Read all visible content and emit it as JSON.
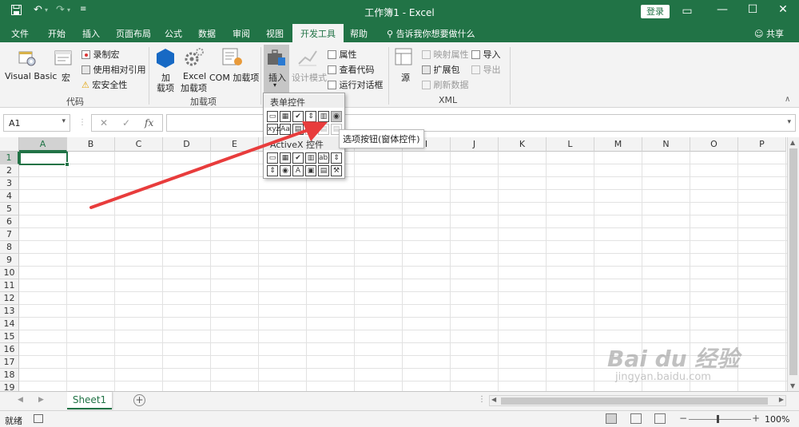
{
  "titlebar": {
    "title": "工作簿1  -  Excel",
    "login": "登录",
    "save_icon": "save-icon",
    "minimize": "—",
    "maximize": "☐",
    "close": "✕",
    "ribbon_opts": "▭"
  },
  "tabs": [
    "文件",
    "开始",
    "插入",
    "页面布局",
    "公式",
    "数据",
    "审阅",
    "视图",
    "开发工具",
    "帮助"
  ],
  "active_tab": "开发工具",
  "tellme": "告诉我你想要做什么",
  "share": "共享",
  "ribbon": {
    "code": {
      "label": "代码",
      "visual_basic": "Visual Basic",
      "macros": "宏",
      "record_macro": "录制宏",
      "relative_ref": "使用相对引用",
      "macro_security": "宏安全性"
    },
    "addins": {
      "label": "加载项",
      "addins_l1": "加",
      "addins_l2": "载项",
      "excel_l1": "Excel",
      "excel_l2": "加载项",
      "com": "COM 加载项"
    },
    "controls": {
      "insert": "插入",
      "design_mode": "设计模式",
      "properties": "属性",
      "view_code": "查看代码",
      "run_dialog": "运行对话框"
    },
    "xml": {
      "label": "XML",
      "source": "源",
      "map_properties": "映射属性",
      "expansion_packs": "扩展包",
      "refresh_data": "刷新数据",
      "import": "导入",
      "export": "导出"
    }
  },
  "formula_bar": {
    "name_box": "A1",
    "cancel": "✕",
    "enter": "✓",
    "fx": "fx",
    "value": ""
  },
  "grid": {
    "columns": [
      "A",
      "B",
      "C",
      "D",
      "E",
      "F",
      "G",
      "H",
      "I",
      "J",
      "K",
      "L",
      "M",
      "N",
      "O",
      "P"
    ],
    "rows": [
      "1",
      "2",
      "3",
      "4",
      "5",
      "6",
      "7",
      "8",
      "9",
      "10",
      "11",
      "12",
      "13",
      "14",
      "15",
      "16",
      "17",
      "18",
      "19"
    ],
    "active_cell": "A1"
  },
  "dropdown": {
    "form_controls_header": "表单控件",
    "activex_header": "ActiveX 控件",
    "tooltip": "选项按钮(窗体控件)",
    "form_row1": [
      "▭",
      "▦",
      "✔",
      "⇕",
      "▥",
      "◉"
    ],
    "form_row2": [
      "xyz",
      "Aa",
      "▤",
      "◻",
      "▤",
      "▤"
    ],
    "activex_row1": [
      "▭",
      "▦",
      "✔",
      "▥",
      "ab|",
      "⇕"
    ],
    "activex_row2": [
      "⇕",
      "◉",
      "A",
      "▣",
      "▤",
      "⚒"
    ]
  },
  "sheets": {
    "active": "Sheet1",
    "add": "+"
  },
  "status": {
    "ready": "就绪",
    "zoom": "100%",
    "minus": "−",
    "plus": "+"
  },
  "watermark": {
    "logo": "Bai du 经验",
    "url": "jingyan.baidu.com"
  },
  "colors": {
    "excel_green": "#217346",
    "annotation_arrow": "#e83c3c"
  }
}
